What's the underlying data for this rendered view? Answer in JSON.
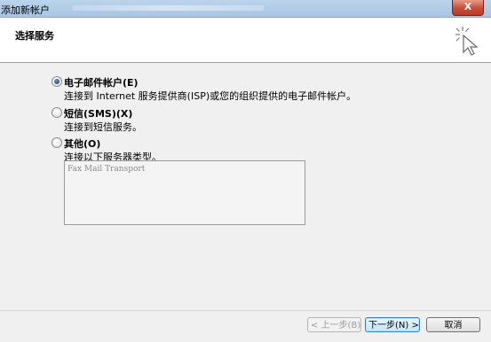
{
  "window": {
    "title": "添加新帐户",
    "close_label": "X"
  },
  "header": {
    "title": "选择服务",
    "icon": "wizard-wand-icon"
  },
  "options": [
    {
      "label": "电子邮件帐户(E)",
      "description": "连接到 Internet 服务提供商(ISP)或您的组织提供的电子邮件帐户。",
      "selected": true
    },
    {
      "label": "短信(SMS)(X)",
      "description": "连接到短信服务。",
      "selected": false
    },
    {
      "label": "其他(O)",
      "description": "连接以下服务器类型。",
      "selected": false
    }
  ],
  "server_types": [
    "Fax Mail Transport"
  ],
  "footer": {
    "back_label": "< 上一步(B)",
    "next_label": "下一步(N) >",
    "cancel_label": "取消"
  }
}
